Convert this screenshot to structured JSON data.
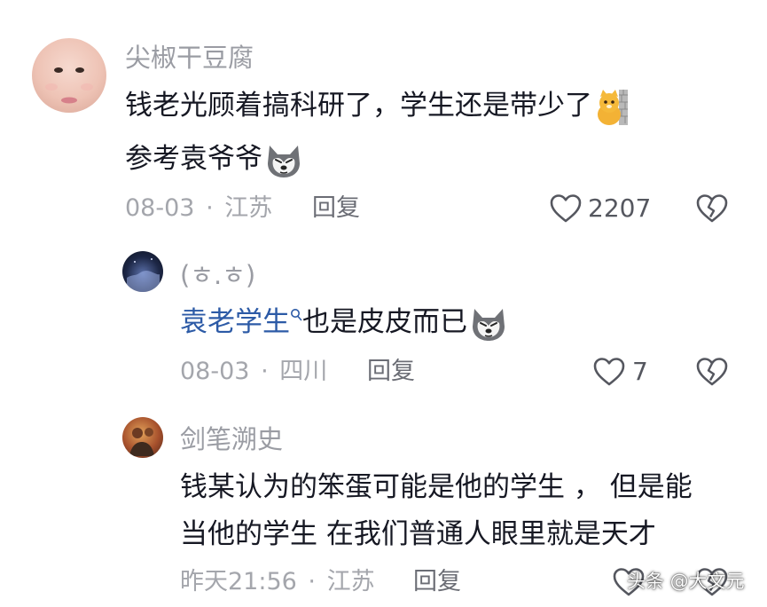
{
  "comments": [
    {
      "username": "尖椒干豆腐",
      "lines": [
        "钱老光顾着搞科研了，学生还是带少了",
        "参考袁爷爷"
      ],
      "emojis": [
        "cat-doll-emoji",
        "husky-emoji"
      ],
      "date": "08-03",
      "location": "江苏",
      "reply_label": "回复",
      "likes": "2207"
    },
    {
      "username": "(ㅎ.ㅎ)",
      "mention": "袁老学生",
      "text": "也是皮皮而已",
      "emojis": [
        "husky-emoji"
      ],
      "date": "08-03",
      "location": "四川",
      "reply_label": "回复",
      "likes": "7"
    },
    {
      "username": "剑笔溯史",
      "lines": [
        "钱某认为的笨蛋可能是他的学生 ， 但是能",
        "当他的学生 在我们普通人眼里就是天才"
      ],
      "date": "昨天21:56",
      "location": "江苏",
      "reply_label": "回复"
    }
  ],
  "meta_separator": "·",
  "watermark": "头条 @大文元",
  "colors": {
    "text": "#161823",
    "name": "#9a9ca3",
    "meta": "#a4a6ac",
    "mention": "#2c5aa6"
  }
}
